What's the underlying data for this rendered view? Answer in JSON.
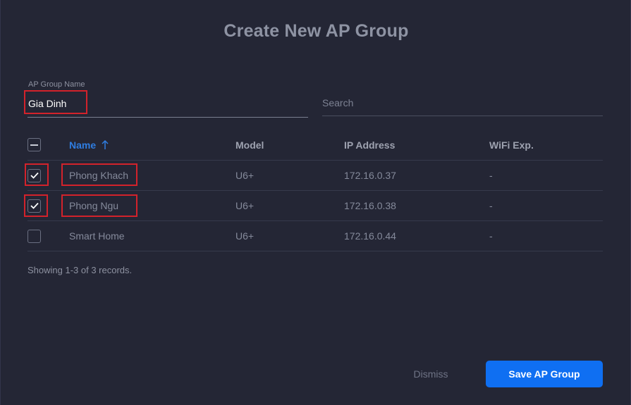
{
  "dialog": {
    "title": "Create New AP Group"
  },
  "form": {
    "name_label": "AP Group Name",
    "name_value": "Gia Dinh",
    "search_placeholder": "Search",
    "search_value": ""
  },
  "table": {
    "columns": [
      "Name",
      "Model",
      "IP Address",
      "WiFi Exp."
    ],
    "sort": {
      "column": "Name",
      "direction": "ascending",
      "icon": "arrow-up-icon"
    },
    "header_checkbox": "indeterminate",
    "rows": [
      {
        "checked": true,
        "name": "Phong Khach",
        "model": "U6+",
        "ip": "172.16.0.37",
        "wifi_exp": "-"
      },
      {
        "checked": true,
        "name": "Phong Ngu",
        "model": "U6+",
        "ip": "172.16.0.38",
        "wifi_exp": "-"
      },
      {
        "checked": false,
        "name": "Smart Home",
        "model": "U6+",
        "ip": "172.16.0.44",
        "wifi_exp": "-"
      }
    ]
  },
  "records_text": "Showing 1-3 of 3 records.",
  "buttons": {
    "dismiss": "Dismiss",
    "save": "Save AP Group"
  },
  "colors": {
    "background": "#242635",
    "accent": "#0f6ff2",
    "sort_header": "#2f7de1",
    "annotation_highlight": "#d3222b"
  }
}
